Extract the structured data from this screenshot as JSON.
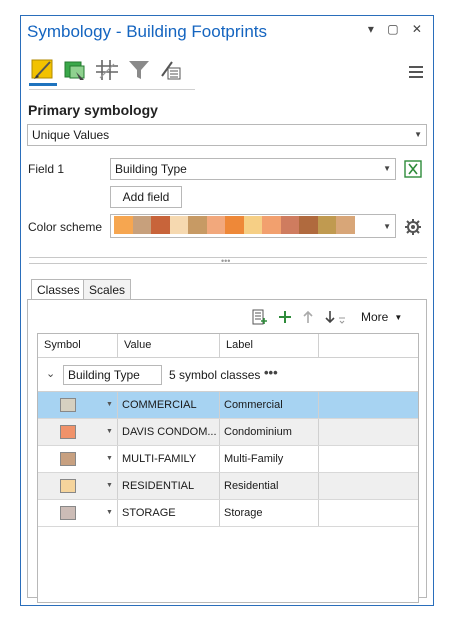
{
  "window": {
    "title": "Symbology - Building Footprints",
    "controls": "▾ ▢ ✕"
  },
  "section": {
    "primary_heading": "Primary symbology"
  },
  "renderer": {
    "selected": "Unique Values"
  },
  "field1": {
    "label": "Field 1",
    "value": "Building Type"
  },
  "add_field": {
    "label": "Add field"
  },
  "color_scheme": {
    "label": "Color scheme",
    "colors": [
      "#f6a650",
      "#c7a07c",
      "#c8643a",
      "#f6d9b0",
      "#c79a64",
      "#f2a87c",
      "#ee8838",
      "#f6cf85",
      "#f2a06e",
      "#cf7c5f",
      "#b06a3e",
      "#c09a50",
      "#d8a678"
    ]
  },
  "tabs": {
    "classes": "Classes",
    "scales": "Scales"
  },
  "class_toolbar": {
    "more": "More"
  },
  "table": {
    "headers": {
      "symbol": "Symbol",
      "value": "Value",
      "label": "Label"
    },
    "group": {
      "field_value": "Building Type",
      "count_text": "5 symbol classes"
    },
    "rows": [
      {
        "color": "#d6d0c0",
        "value": "COMMERCIAL",
        "label": "Commercial",
        "selected": true
      },
      {
        "color": "#f0926a",
        "value": "DAVIS CONDOM...",
        "label": "Condominium",
        "selected": false
      },
      {
        "color": "#c7a080",
        "value": "MULTI-FAMILY",
        "label": "Multi-Family",
        "selected": false
      },
      {
        "color": "#f5d49c",
        "value": "RESIDENTIAL",
        "label": "Residential",
        "selected": false
      },
      {
        "color": "#ccbcb6",
        "value": "STORAGE",
        "label": "Storage",
        "selected": false
      }
    ],
    "selected_color": "#a7d3f2",
    "alt_color": "#efefef"
  }
}
